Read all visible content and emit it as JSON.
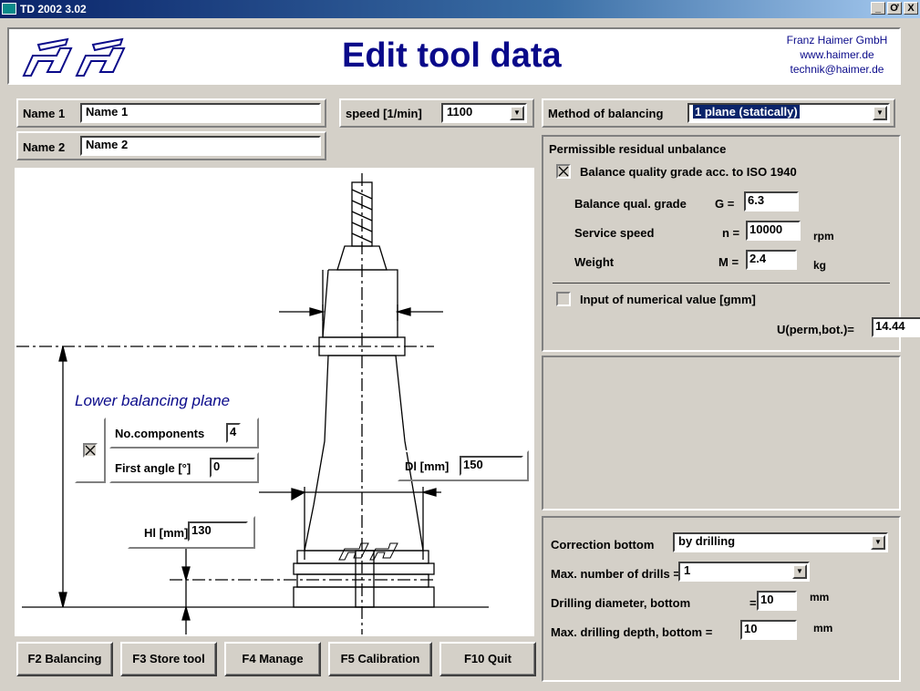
{
  "window": {
    "title": "TD 2002 3.02",
    "minimize": "_",
    "maximize": "Ơ",
    "close": "X"
  },
  "header": {
    "title": "Edit tool data",
    "company": [
      "Franz Haimer GmbH",
      "www.haimer.de",
      "technik@haimer.de"
    ]
  },
  "names": {
    "name1_label": "Name 1",
    "name1_value": "Name 1",
    "name2_label": "Name 2",
    "name2_value": "Name 2"
  },
  "speed": {
    "label": "speed [1/min]",
    "value": "1100"
  },
  "method": {
    "label": "Method of balancing",
    "value": "1 plane (statically)"
  },
  "drawing": {
    "plane_label": "Lower balancing plane",
    "components_label": "No.components",
    "components_value": "4",
    "first_angle_label": "First angle [°]",
    "first_angle_value": "0",
    "dl_label": "Dl [mm]",
    "dl_value": "150",
    "hl_label": "Hl [mm]",
    "hl_value": "130"
  },
  "unbalance": {
    "section_title": "Permissible residual unbalance",
    "iso_label": "Balance quality grade acc. to ISO 1940",
    "iso_checked": true,
    "grade_label": "Balance qual. grade",
    "grade_symbol": "G =",
    "grade_value": "6.3",
    "speed_label": "Service speed",
    "speed_symbol": "n =",
    "speed_value": "10000",
    "speed_unit": "rpm",
    "weight_label": "Weight",
    "weight_symbol": "M =",
    "weight_value": "2.4",
    "weight_unit": "kg",
    "numeric_label": "Input of numerical value [gmm]",
    "numeric_checked": false,
    "uperm_label": "U(perm,bot.)=",
    "uperm_value": "14.44"
  },
  "correction": {
    "label": "Correction bottom",
    "value": "by drilling",
    "drills_label": "Max. number of drills =",
    "drills_value": "1",
    "diameter_label": "Drilling diameter, bottom",
    "diameter_eq": "=",
    "diameter_value": "10",
    "diameter_unit": "mm",
    "depth_label": "Max. drilling depth, bottom =",
    "depth_value": "10",
    "depth_unit": "mm"
  },
  "buttons": {
    "f2": "F2 Balancing",
    "f3": "F3 Store tool",
    "f4": "F4 Manage",
    "f5": "F5 Calibration",
    "f10": "F10 Quit"
  },
  "colors": {
    "title_blue": "#0a0a8a",
    "selection": "#0a246a",
    "panel": "#d4d0c8"
  }
}
